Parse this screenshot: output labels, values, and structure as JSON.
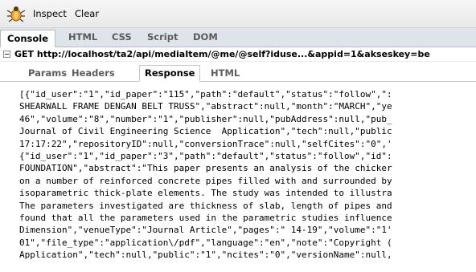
{
  "toolbar": {
    "logo_icon": "firebug-icon",
    "inspect_label": "Inspect",
    "clear_label": "Clear"
  },
  "panel_tabs": [
    {
      "label": "Console",
      "active": true
    },
    {
      "label": "HTML",
      "active": false
    },
    {
      "label": "CSS",
      "active": false
    },
    {
      "label": "Script",
      "active": false
    },
    {
      "label": "DOM",
      "active": false
    }
  ],
  "request": {
    "text": "GET http://localhost/ta2/api/mediaItem/@me/@self?iduse...&appid=1&akseskey=be"
  },
  "sub_tabs": [
    {
      "label": "Params",
      "active": false
    },
    {
      "label": "Headers",
      "active": false
    },
    {
      "label": "Response",
      "active": true
    },
    {
      "label": "HTML",
      "active": false
    }
  ],
  "response_lines": [
    "[{\"id_user\":\"1\",\"id_paper\":\"115\",\"path\":\"default\",\"status\":\"follow\",\":",
    "SHEARWALL FRAME DENGAN BELT TRUSS\",\"abstract\":null,\"month\":\"MARCH\",\"ye",
    "46\",\"volume\":\"8\",\"number\":\"1\",\"publisher\":null,\"pubAddress\":null,\"pub_",
    "Journal of Civil Engineering Science  Application\",\"tech\":null,\"public",
    "17:17:22\",\"repositoryID\":null,\"conversionTrace\":null,\"selfCites\":\"0\",'",
    "{\"id_user\":\"1\",\"id_paper\":\"3\",\"path\":\"default\",\"status\":\"follow\",\"id\":",
    "FOUNDATION\",\"abstract\":\"This paper presents an analysis of the chicker",
    "on a number of reinforced concrete pipes filled with and surrounded by",
    "isoparametric thick-plate elements. The study was intended to illustra",
    "The parameters investigated are thickness of slab, length of pipes and",
    "found that all the parameters used in the parametric studies influence",
    "Dimension\",\"venueType\":\"Journal Article\",\"pages\":\" 14-19\",\"volume\":\"1'",
    "01\",\"file_type\":\"application\\/pdf\",\"language\":\"en\",\"note\":\"Copyright (",
    "Application\",\"tech\":null,\"public\":\"1\",\"ncites\":\"0\",\"versionName\":null,"
  ]
}
